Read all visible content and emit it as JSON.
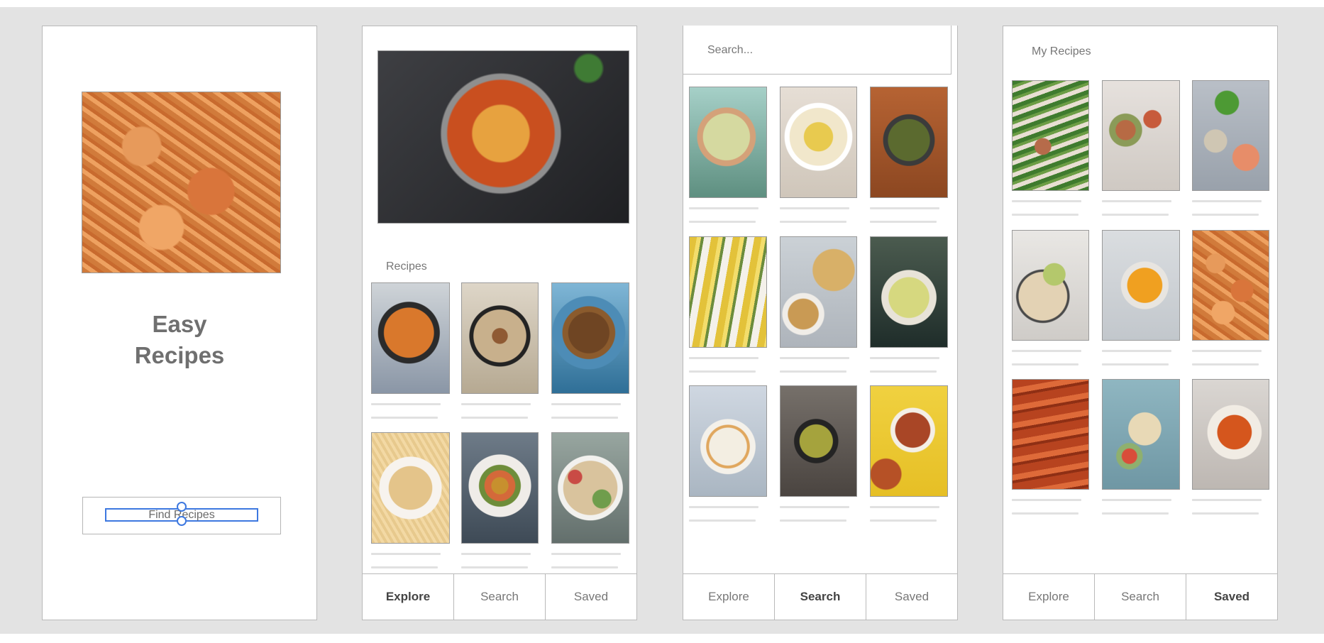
{
  "splash": {
    "title_line1": "Easy",
    "title_line2": "Recipes",
    "button_label": "Find Recipes"
  },
  "explore": {
    "section_label": "Recipes",
    "hero_image": "gnocchi-bake"
  },
  "search": {
    "placeholder": "Search..."
  },
  "saved": {
    "section_label": "My Recipes"
  },
  "tabs": {
    "explore": "Explore",
    "search": "Search",
    "saved": "Saved"
  },
  "active_tabs": [
    "Explore",
    "Search",
    "Saved"
  ],
  "colors": {
    "canvas": "#e3e3e3",
    "selection": "#3d78e0"
  },
  "icons": [
    "selection-handle-icon"
  ]
}
